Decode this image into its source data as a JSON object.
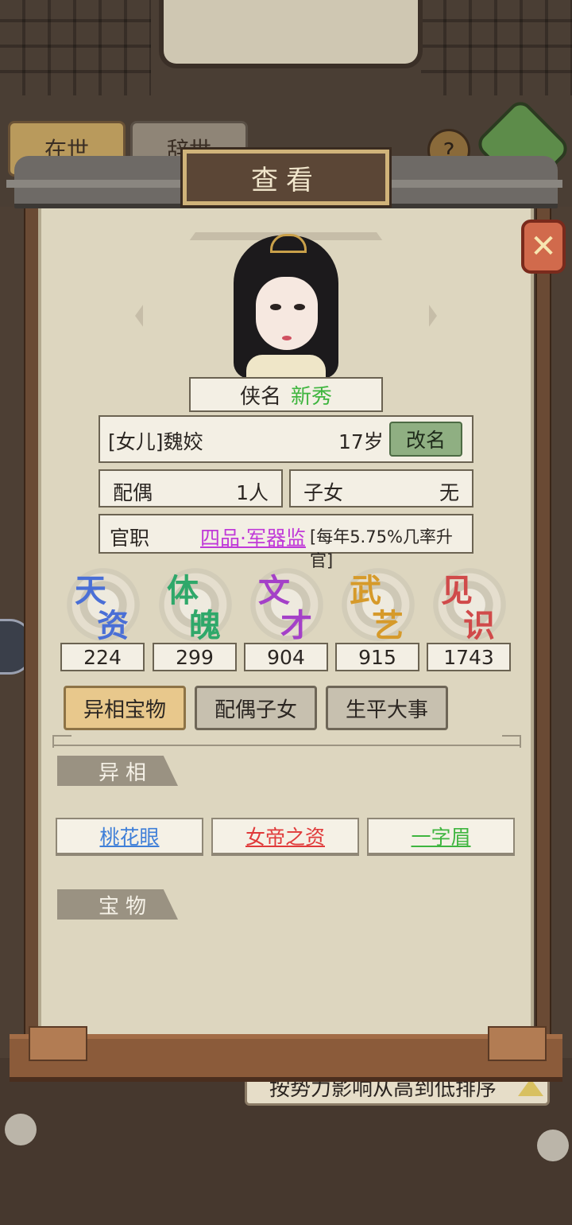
{
  "top_tabs": {
    "alive": "在世",
    "dead": "辞世"
  },
  "help_icon": "?",
  "dialog_title": "查看",
  "close_icon": "close-x-icon",
  "character": {
    "title_label": "侠名",
    "title_value": "新秀",
    "title_value_color": "#3fb53f",
    "name": "[女儿]魏姣",
    "age": "17岁",
    "rename_label": "改名"
  },
  "family": {
    "spouse_label": "配偶",
    "spouse_value": "1人",
    "children_label": "子女",
    "children_value": "无"
  },
  "office": {
    "label": "官职",
    "value": "四品·军器监",
    "rate": "[每年5.75%几率升官]",
    "value_color": "#c03ad8"
  },
  "stats": [
    {
      "c1": "天",
      "c2": "资",
      "value": "224",
      "color": "#4a6fd6"
    },
    {
      "c1": "体",
      "c2": "魄",
      "value": "299",
      "color": "#2fa86a"
    },
    {
      "c1": "文",
      "c2": "才",
      "value": "904",
      "color": "#a440c8"
    },
    {
      "c1": "武",
      "c2": "艺",
      "value": "915",
      "color": "#d69a2a"
    },
    {
      "c1": "见",
      "c2": "识",
      "value": "1743",
      "color": "#d04a4a"
    }
  ],
  "tabs": [
    {
      "label": "异相宝物",
      "active": true
    },
    {
      "label": "配偶子女",
      "active": false
    },
    {
      "label": "生平大事",
      "active": false
    }
  ],
  "sections": {
    "traits": "异相",
    "treasures": "宝物"
  },
  "traits": [
    {
      "label": "桃花眼",
      "color": "#3f7fd8"
    },
    {
      "label": "女帝之资",
      "color": "#e03a3a"
    },
    {
      "label": "一字眉",
      "color": "#3fb53f"
    }
  ],
  "sort_bar": "按势力影响从高到低排序"
}
